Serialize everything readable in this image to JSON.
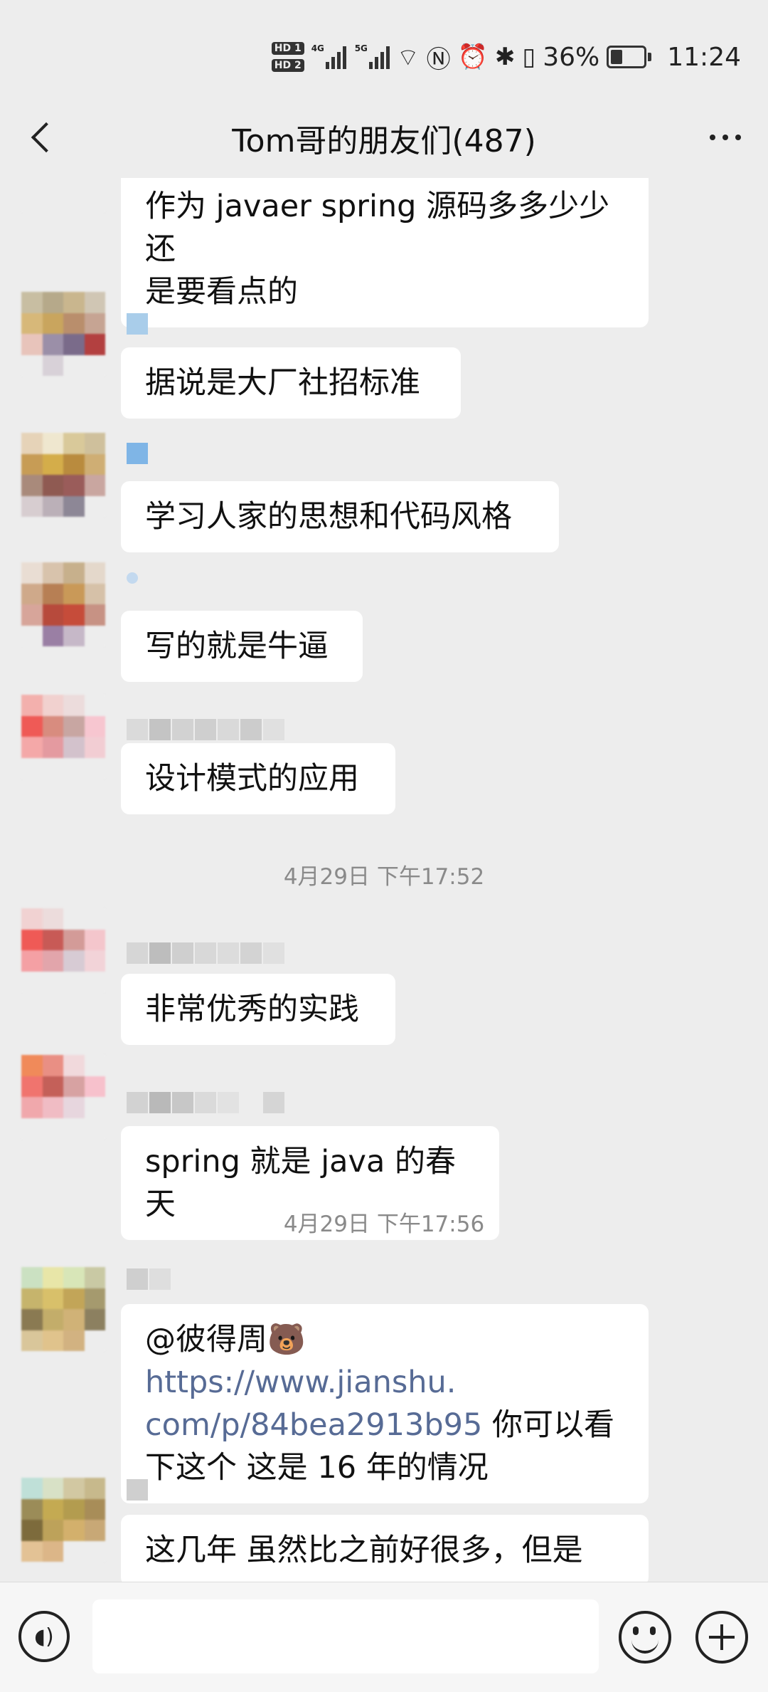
{
  "status_bar": {
    "hd1": "HD 1",
    "hd2": "HD 2",
    "net1": "4G",
    "net2": "5G",
    "battery": "36%",
    "battery_level": 0.36,
    "time": "11:24",
    "icons": [
      "nfc-icon",
      "alarm-icon",
      "bluetooth-icon",
      "vibrate-icon"
    ]
  },
  "header": {
    "title": "Tom哥的朋友们(487)"
  },
  "chat": {
    "messages": [
      {
        "text": "作为 javaer spring 源码多多少少还\n是要看点的"
      },
      {
        "text": "据说是大厂社招标准"
      },
      {
        "text": "学习人家的思想和代码风格"
      },
      {
        "text": "写的就是牛逼"
      },
      {
        "text": "设计模式的应用"
      },
      {
        "text": "非常优秀的实践"
      },
      {
        "text": "spring 就是 java 的春天"
      },
      {
        "mention": "@彼得周🐻 ",
        "link": "https://www.jianshu.\ncom/p/84bea2913b95",
        "text": "  你可以看\n下这个   这是 16 年的情况"
      },
      {
        "text": "这几年 虽然比之前好很多，但是"
      }
    ],
    "timestamps": [
      "4月29日 下午17:52",
      "4月29日 下午17:56"
    ]
  },
  "input_bar": {
    "value": ""
  }
}
